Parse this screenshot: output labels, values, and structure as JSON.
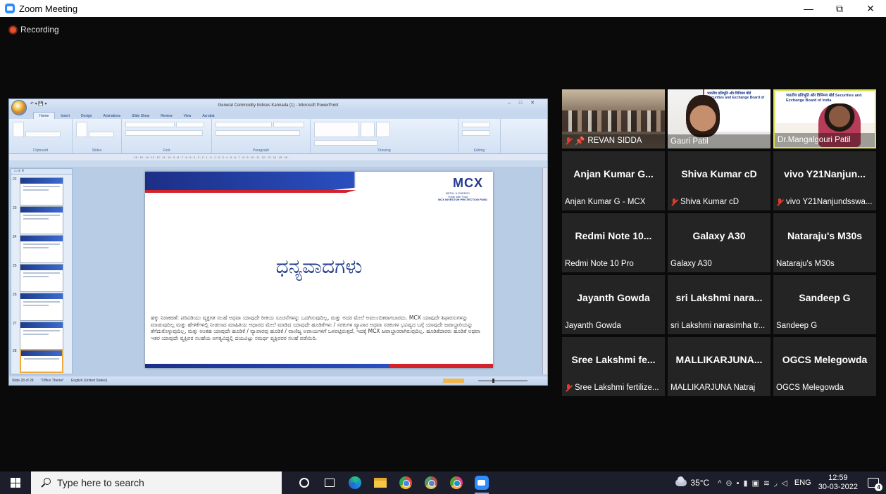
{
  "window": {
    "title": "Zoom Meeting",
    "controls": {
      "minimize": "—",
      "maximize": "⧉",
      "close": "✕"
    }
  },
  "recording": {
    "label": "Recording",
    "color": "#e8502e"
  },
  "shared_screen": {
    "app_title": "General Commodity Indices Kannada (1) - Microsoft PowerPoint",
    "tabs": [
      "Home",
      "Insert",
      "Design",
      "Animations",
      "Slide Show",
      "Review",
      "View",
      "Acrobat"
    ],
    "ribbon_groups": [
      "Clipboard",
      "Slides",
      "Font",
      "Paragraph",
      "Drawing",
      "Editing"
    ],
    "slide_numbers": [
      "22",
      "23",
      "24",
      "25",
      "26",
      "27",
      "28"
    ],
    "slide": {
      "logo": "MCX",
      "logo_sub": "METAL & ENERGY",
      "logo_tagline": "Trade with Trust",
      "fund_line": "MCX INVESTOR PROTECTION FUND",
      "heading": "ಧನ್ಯವಾದಗಳು",
      "disclaimer": "ಹಕ್ಕು ನಿರಾಕರಣೆ: ಪರಿವಿಡಿಯು ವ್ಯಕ್ತಿಗತ ಸಲಹೆ ಅಥವಾ ಯಾವುದೇ ರೀತಿಯ ಸೂಚನೆಗಳನ್ನು ಒದಗಿಸುವುದಿಲ್ಲ, ಮತ್ತು ಅದರ ಮೇಲೆ ಅವಲಂಬಿತರಾಗಬಾರದು. MCX ಯಾವುದೇ ಶಿಫಾರಸುಗಳನ್ನು ಮಾಡುವುದಿಲ್ಲ ಮತ್ತು ಹೇಳಿಕೆಗಳಲ್ಲಿ ನೀಡಲಾದ ಮಾಹಿತಿಯ ಆಧಾರದ ಮೇಲೆ ಮಾಡಿದ ಯಾವುದೇ ಹೂಡಿಕೆಗಳು / ಸರಕುಗಳ ವ್ಯಾಪಾರ ಅಥವಾ ಸರಕುಗಳ ಭವಿಷ್ಯದ ಬಗ್ಗೆ ಯಾವುದೇ ಜವಾಬ್ದಾರಿಯನ್ನು ತೆಗೆದುಕೊಳ್ಳುವುದಿಲ್ಲ, ಮತ್ತು ಅಂತಹ ಯಾವುದೇ ಹೂಡಿಕೆ / ವ್ಯಾಪಾರವು ಹೂಡಿಕೆ / ವಾಣಿಜ್ಯ ಅಪಾಯಗಳಿಗೆ ಒಳಪಟ್ಟಿರುತ್ತದೆ, ಇದಕ್ಕೆ MCX ಜವಾಬ್ದಾರರಾಗಿರುವುದಿಲ್ಲ. ಹೂಡಿಕೆದಾರರು ಹೂಡಿಕೆ ಅಥವಾ ಇತರ ಯಾವುದೇ ವ್ಯಕ್ತಿಪರ ಸಲಹೆಯ ಅಗತ್ಯವಿದ್ದಲ್ಲಿ ದಯವಿಟ್ಟು ಸಮರ್ಥ ವ್ಯಕ್ತಿಪರರ ಸಲಹೆ ಪಡೆಯಿರಿ."
    },
    "status": {
      "slide": "Slide 28 of 28",
      "theme": "\"Office Theme\"",
      "language": "English (United States)"
    }
  },
  "participants": [
    {
      "tile_name": "",
      "label": "REVAN SIDDA",
      "muted": true,
      "pinned": true,
      "video": "room"
    },
    {
      "tile_name": "",
      "label": "Gauri Patil",
      "muted": false,
      "video": "woman"
    },
    {
      "tile_name": "",
      "label": "Dr.Mangalgouri Patil",
      "muted": false,
      "video": "speaker",
      "active_speaker": true
    },
    {
      "tile_name": "Anjan Kumar G...",
      "label": "Anjan Kumar G - MCX",
      "muted": false
    },
    {
      "tile_name": "Shiva Kumar cD",
      "label": "Shiva Kumar cD",
      "muted": true
    },
    {
      "tile_name": "vivo Y21Nanjun...",
      "label": "vivo Y21Nanjundsswa...",
      "muted": true
    },
    {
      "tile_name": "Redmi Note 10...",
      "label": "Redmi Note 10 Pro",
      "muted": false
    },
    {
      "tile_name": "Galaxy A30",
      "label": "Galaxy A30",
      "muted": false
    },
    {
      "tile_name": "Nataraju's M30s",
      "label": "Nataraju's M30s",
      "muted": false
    },
    {
      "tile_name": "Jayanth Gowda",
      "label": "Jayanth Gowda",
      "muted": false
    },
    {
      "tile_name": "sri Lakshmi nara...",
      "label": "sri Lakshmi narasimha tr...",
      "muted": false
    },
    {
      "tile_name": "Sandeep G",
      "label": "Sandeep G",
      "muted": false
    },
    {
      "tile_name": "Sree Lakshmi fe...",
      "label": "Sree Lakshmi fertilize...",
      "muted": true
    },
    {
      "tile_name": "MALLIKARJUNA...",
      "label": "MALLIKARJUNA Natraj",
      "muted": false
    },
    {
      "tile_name": "OGCS Melegowda",
      "label": "OGCS Melegowda",
      "muted": false
    }
  ],
  "video_tiles": {
    "gauri_banner": "भारतीय प्रतिभूति और विनिमय बोर्ड Securities and Exchange Board of India",
    "speaker_banner": "भारतीय प्रतिभूति और विनिमय बोर्ड Securities and Exchange Board of India"
  },
  "taskbar": {
    "search_placeholder": "Type here to search",
    "icons": [
      "cortana-icon",
      "task-view-icon",
      "edge-icon",
      "file-explorer-icon",
      "chrome-icon",
      "chrome-profile-icon",
      "chrome-alt-icon",
      "zoom-icon"
    ],
    "temperature": "35°C",
    "language": "ENG",
    "time": "12:59",
    "date": "30-03-2022",
    "notifications": "4"
  }
}
